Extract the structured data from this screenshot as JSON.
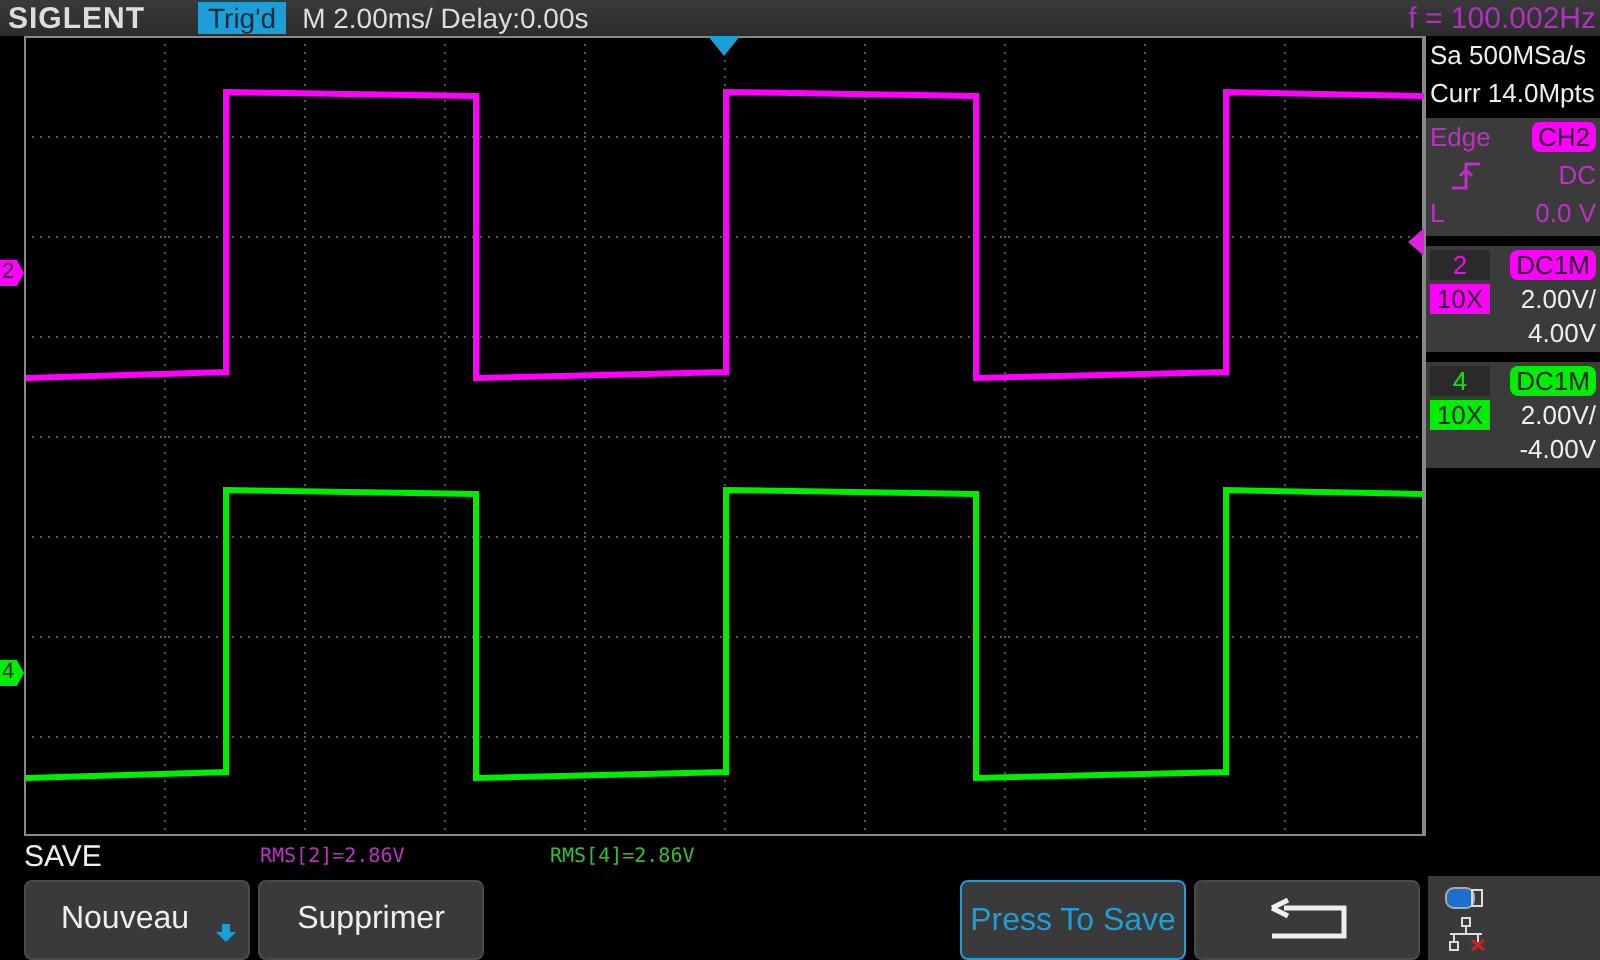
{
  "header": {
    "brand": "SIGLENT",
    "trigger_status": "Trig'd",
    "timebase": "M 2.00ms/ Delay:0.00s",
    "frequency": "f = 100.002Hz"
  },
  "acquisition": {
    "sample_rate": "Sa 500MSa/s",
    "memory_depth": "Curr 14.0Mpts"
  },
  "trigger": {
    "type": "Edge",
    "source": "CH2",
    "coupling": "DC",
    "level_label": "L",
    "level_value": "0.0 V"
  },
  "channels": [
    {
      "number": "2",
      "marker": "2",
      "color": "#ff00ff",
      "coupling": "DC1M",
      "probe": "10X",
      "scale": "2.00V/",
      "offset": "4.00V"
    },
    {
      "number": "4",
      "marker": "4",
      "color": "#00ee00",
      "coupling": "DC1M",
      "probe": "10X",
      "scale": "2.00V/",
      "offset": "-4.00V"
    }
  ],
  "measurements": [
    {
      "text": "RMS[2]=2.86V",
      "color": "#c030c8"
    },
    {
      "text": "RMS[4]=2.86V",
      "color": "#30c030"
    }
  ],
  "menu": {
    "title": "SAVE",
    "buttons": [
      {
        "kind": "dropdown",
        "label": "Nouveau"
      },
      {
        "kind": "plain",
        "label": "Supprimer"
      },
      {
        "kind": "empty"
      },
      {
        "kind": "empty"
      },
      {
        "kind": "highlight",
        "label": "Press To Save"
      },
      {
        "kind": "back"
      }
    ]
  }
}
